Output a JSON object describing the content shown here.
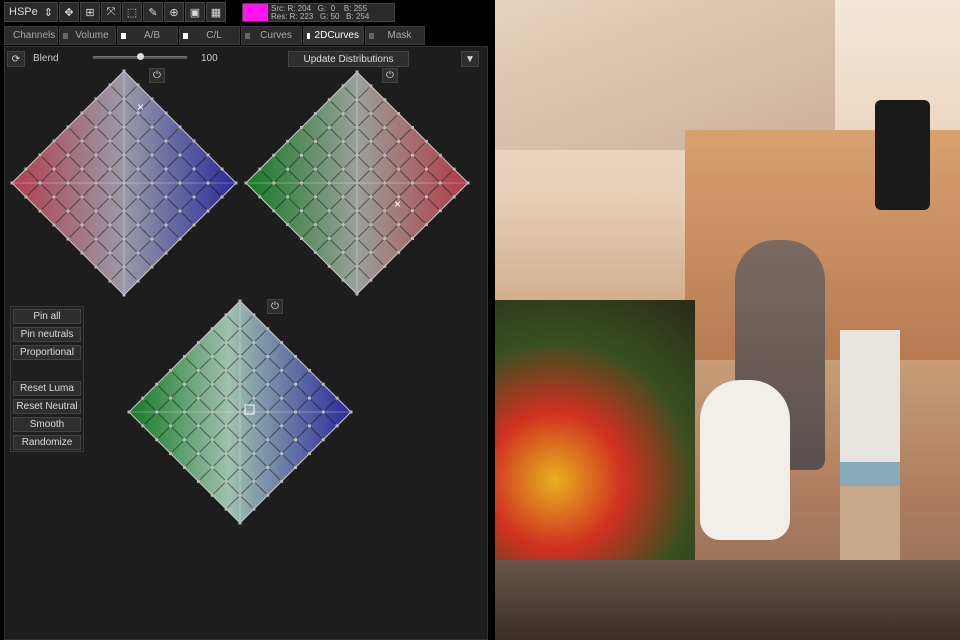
{
  "toolbar": {
    "mode": "HSPe",
    "tools": [
      "move-icon",
      "transform-icon",
      "collapse-icon",
      "marquee-icon",
      "eyedropper-icon",
      "zoom-icon",
      "frame-icon",
      "grid-icon"
    ]
  },
  "color_info": {
    "swatch": "#ff14f0",
    "src": "Src: R: 204   G:  0    B: 255",
    "res": "Res: R: 223   G: 50   B: 254"
  },
  "tabs": [
    {
      "label": "Channels",
      "on": false
    },
    {
      "label": "Volume",
      "on": false
    },
    {
      "label": "A/B",
      "on": true
    },
    {
      "label": "C/L",
      "on": true
    },
    {
      "label": "Curves",
      "on": false
    },
    {
      "label": "2DCurves",
      "on": true
    },
    {
      "label": "Mask",
      "on": false
    }
  ],
  "blend": {
    "label": "Blend",
    "value": "100",
    "fraction": 0.5
  },
  "update_label": "Update Distributions",
  "side_buttons": [
    "Pin all",
    "Pin neutrals",
    "Proportional",
    "Reset Luma",
    "Reset Neutral",
    "Smooth",
    "Randomize"
  ]
}
